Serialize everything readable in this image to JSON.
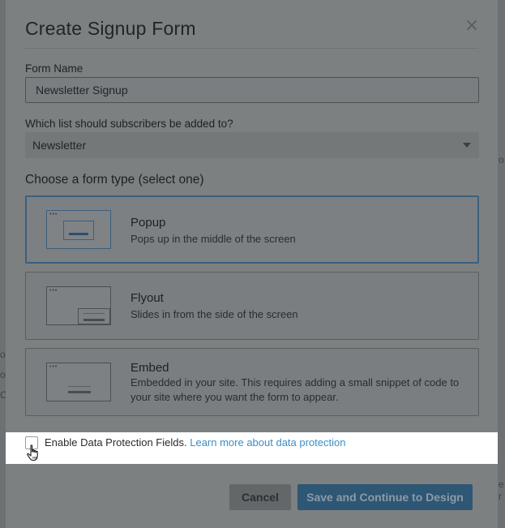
{
  "modal": {
    "title": "Create Signup Form",
    "close_label": "×"
  },
  "form_name": {
    "label": "Form Name",
    "value": "Newsletter Signup"
  },
  "list_select": {
    "label": "Which list should subscribers be added to?",
    "selected": "Newsletter"
  },
  "form_type": {
    "heading": "Choose a form type (select one)",
    "selected": "Popup",
    "options": [
      {
        "title": "Popup",
        "description": "Pops up in the middle of the screen",
        "icon": "popup-thumbnail-icon"
      },
      {
        "title": "Flyout",
        "description": "Slides in from the side of the screen",
        "icon": "flyout-thumbnail-icon"
      },
      {
        "title": "Embed",
        "description": "Embedded in your site. This requires adding a small snippet of code to your site where you want the form to appear.",
        "icon": "embed-thumbnail-icon"
      }
    ]
  },
  "data_protection": {
    "checked": false,
    "label": "Enable Data Protection Fields.",
    "link_text": "Learn more about data protection"
  },
  "actions": {
    "cancel_label": "Cancel",
    "continue_label": "Save and Continue to Design"
  },
  "background_letters": [
    "o",
    "o",
    "C",
    "o",
    "e",
    "r"
  ],
  "colors": {
    "link": "#3b8fc4",
    "primary_button": "#2e5675",
    "selected_border": "#3c5f7d",
    "highlight": "#ffffff"
  }
}
